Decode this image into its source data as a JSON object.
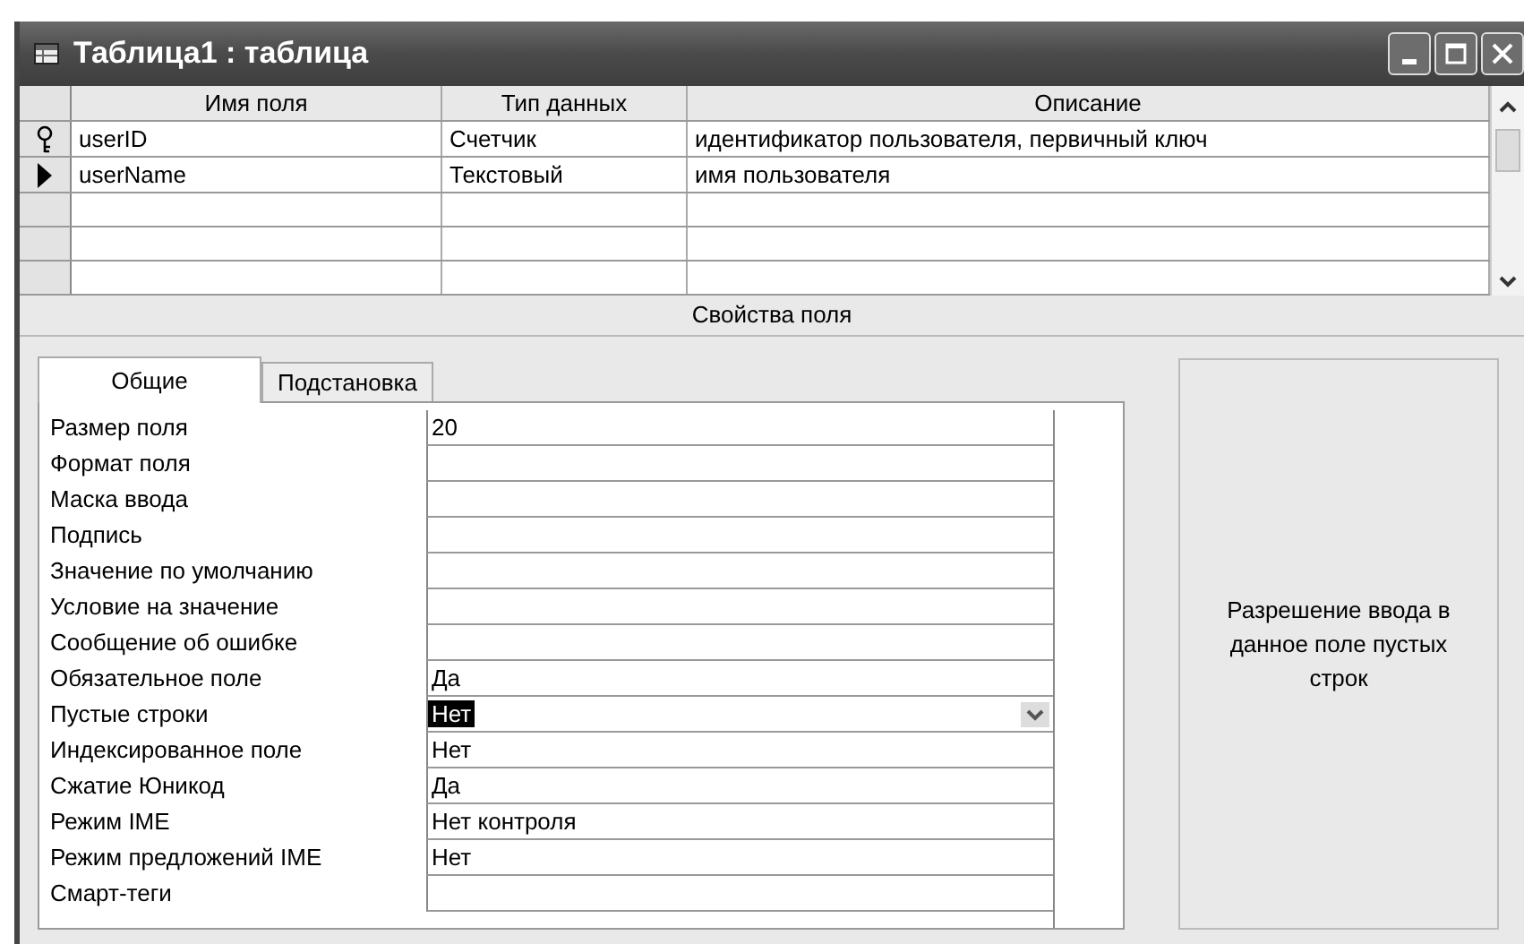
{
  "window": {
    "title": "Таблица1 : таблица"
  },
  "grid": {
    "columns": [
      "Имя поля",
      "Тип данных",
      "Описание"
    ],
    "rows": [
      {
        "name": "userID",
        "type": "Счетчик",
        "description": "идентификатор пользователя, первичный ключ",
        "primary_key": true,
        "selected": false
      },
      {
        "name": "userName",
        "type": "Текстовый",
        "description": "имя пользователя",
        "primary_key": false,
        "selected": true
      }
    ]
  },
  "section_title": "Свойства поля",
  "tabs": [
    {
      "label": "Общие",
      "selected": true
    },
    {
      "label": "Подстановка",
      "selected": false
    }
  ],
  "properties": [
    {
      "label": "Размер поля",
      "value": "20",
      "focused": false
    },
    {
      "label": "Формат поля",
      "focused": false
    },
    {
      "label": "Маска ввода",
      "focused": false
    },
    {
      "label": "Подпись",
      "focused": false
    },
    {
      "label": "Значение по умолчанию",
      "focused": false
    },
    {
      "label": "Условие на значение",
      "focused": false
    },
    {
      "label": "Сообщение об ошибке",
      "focused": false
    },
    {
      "label": "Обязательное поле",
      "value": "Да",
      "focused": false
    },
    {
      "label": "Пустые строки",
      "value": "Нет",
      "focused": true
    },
    {
      "label": "Индексированное поле",
      "value": "Нет",
      "focused": false
    },
    {
      "label": "Сжатие Юникод",
      "value": "Да",
      "focused": false
    },
    {
      "label": "Режим IME",
      "value": "Нет контроля",
      "focused": false
    },
    {
      "label": "Режим предложений IME",
      "value": "Нет",
      "focused": false
    },
    {
      "label": "Смарт-теги",
      "focused": false
    }
  ],
  "help_text": "Разрешение ввода в данное поле пустых строк"
}
